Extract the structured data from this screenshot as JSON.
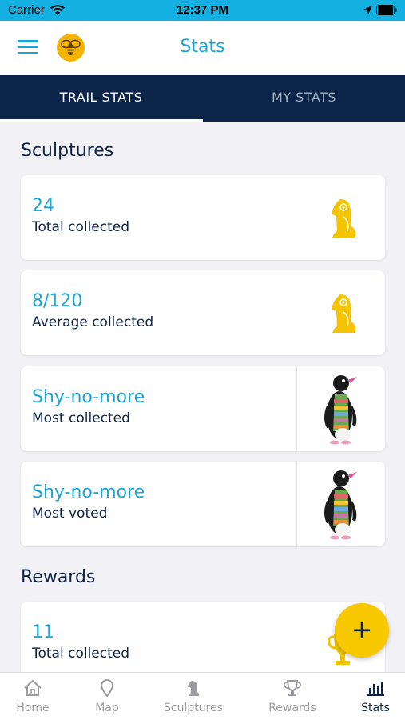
{
  "status_bar": {
    "carrier": "Carrier",
    "time": "12:37 PM"
  },
  "header": {
    "title": "Stats",
    "menu_icon": "hamburger-menu-icon",
    "logo_icon": "bee-logo-icon"
  },
  "tabs": [
    {
      "label": "TRAIL STATS",
      "active": true
    },
    {
      "label": "MY STATS",
      "active": false
    }
  ],
  "sections": {
    "sculptures_title": "Sculptures",
    "rewards_title": "Rewards"
  },
  "cards": [
    {
      "value": "24",
      "label": "Total collected",
      "icon": "penguin-icon"
    },
    {
      "value": "8/120",
      "label": "Average collected",
      "icon": "penguin-icon"
    },
    {
      "value": "Shy-no-more",
      "label": "Most collected",
      "icon": "penguin-sculpture-photo"
    },
    {
      "value": "Shy-no-more",
      "label": "Most voted",
      "icon": "penguin-sculpture-photo"
    }
  ],
  "reward_card": {
    "value": "11",
    "label": "Total collected",
    "icon": "trophy-icon"
  },
  "fab": {
    "symbol": "+"
  },
  "bottom_nav": [
    {
      "label": "Home",
      "icon": "home-icon",
      "active": false
    },
    {
      "label": "Map",
      "icon": "map-pin-icon",
      "active": false
    },
    {
      "label": "Sculptures",
      "icon": "sculpture-icon",
      "active": false
    },
    {
      "label": "Rewards",
      "icon": "trophy-icon",
      "active": false
    },
    {
      "label": "Stats",
      "icon": "bar-chart-icon",
      "active": true
    }
  ],
  "colors": {
    "accent": "#1aa7d8",
    "navy": "#0c2447",
    "yellow": "#f8c800",
    "status_bar": "#15b0e2"
  }
}
